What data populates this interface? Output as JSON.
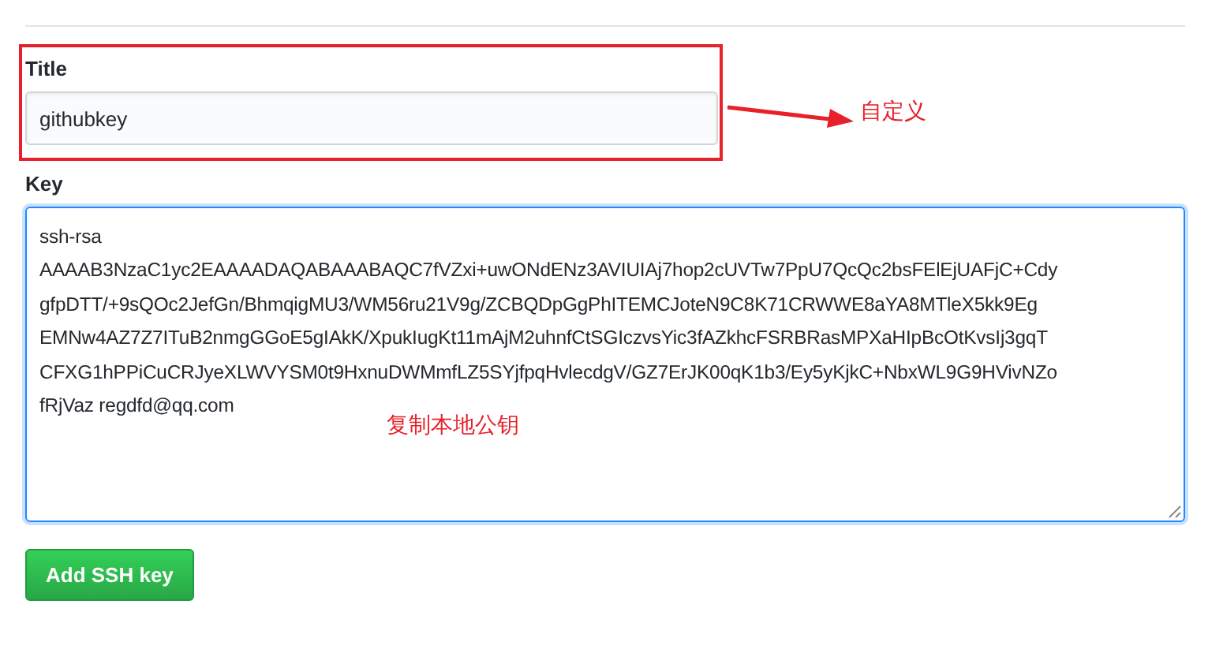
{
  "title_field": {
    "label": "Title",
    "value": "githubkey"
  },
  "key_field": {
    "label": "Key",
    "value_lines": [
      "ssh-rsa",
      "AAAAB3NzaC1yc2EAAAADAQABAAABAQC7fVZxi+uwONdENz3AVIUIAj7hop2cUVTw7PpU7QcQc2bsFElEjUAFjC+Cdy",
      "gfpDTT/+9sQOc2JefGn/BhmqigMU3/WM56ru21V9g/ZCBQDpGgPhITEMCJoteN9C8K71CRWWE8aYA8MTleX5kk9Eg",
      "EMNw4AZ7Z7ITuB2nmgGGoE5gIAkK/XpukIugKt11mAjM2uhnfCtSGIczvsYic3fAZkhcFSRBRasMPXaHIpBcOtKvsIj3gqT",
      "CFXG1hPPiCuCRJyeXLWVYSM0t9HxnuDWMmfLZ5SYjfpqHvlecdgV/GZ7ErJK00qK1b3/Ey5yKjkC+NbxWL9G9HVivNZo",
      "fRjVaz regdfd@qq.com"
    ]
  },
  "annotations": [
    {
      "kind": "title",
      "text": "自定义"
    },
    {
      "kind": "key",
      "text": "复制本地公钥"
    }
  ],
  "submit_button": {
    "label": "Add SSH key"
  }
}
